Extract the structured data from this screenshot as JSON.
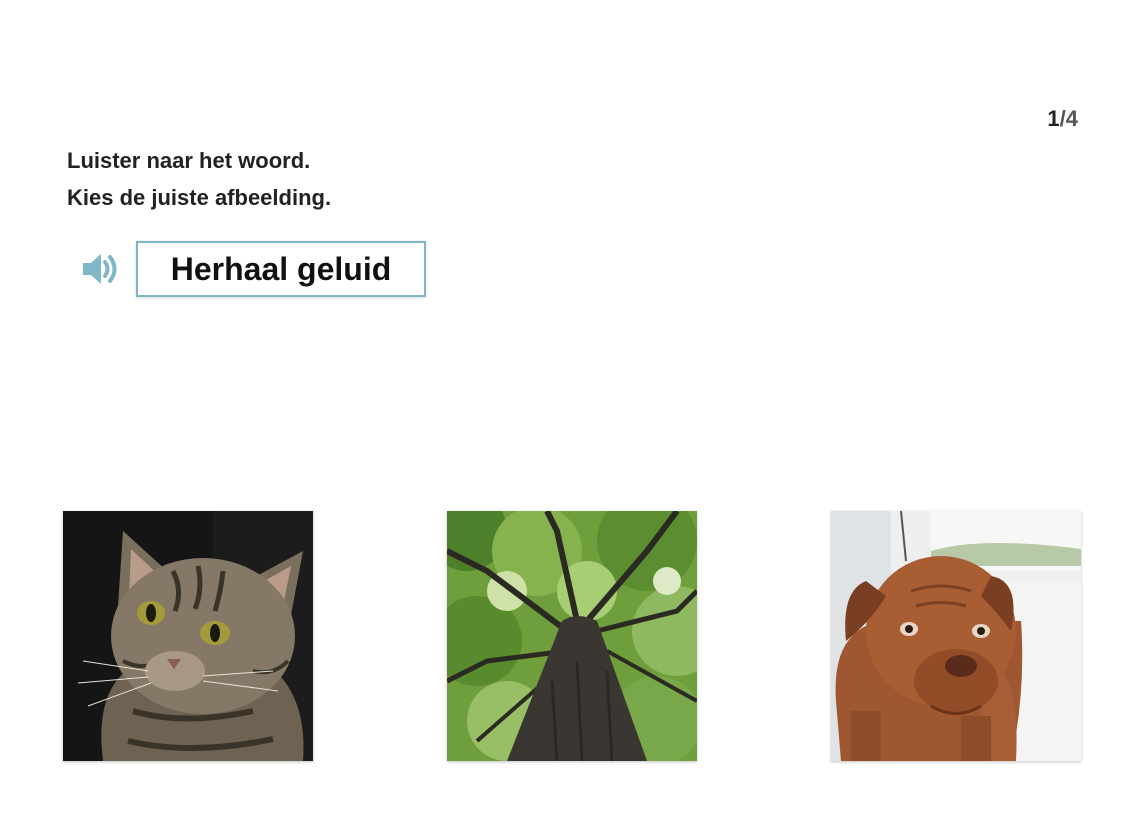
{
  "progress": {
    "current": "1",
    "total": "/4"
  },
  "instructions": {
    "line1": "Luister naar het woord.",
    "line2": "Kies de juiste afbeelding."
  },
  "audio": {
    "icon": "speaker-icon",
    "repeat_label": "Herhaal geluid",
    "accent_color": "#80b7c6"
  },
  "choices": [
    {
      "subject": "cat"
    },
    {
      "subject": "tree"
    },
    {
      "subject": "dog"
    }
  ]
}
